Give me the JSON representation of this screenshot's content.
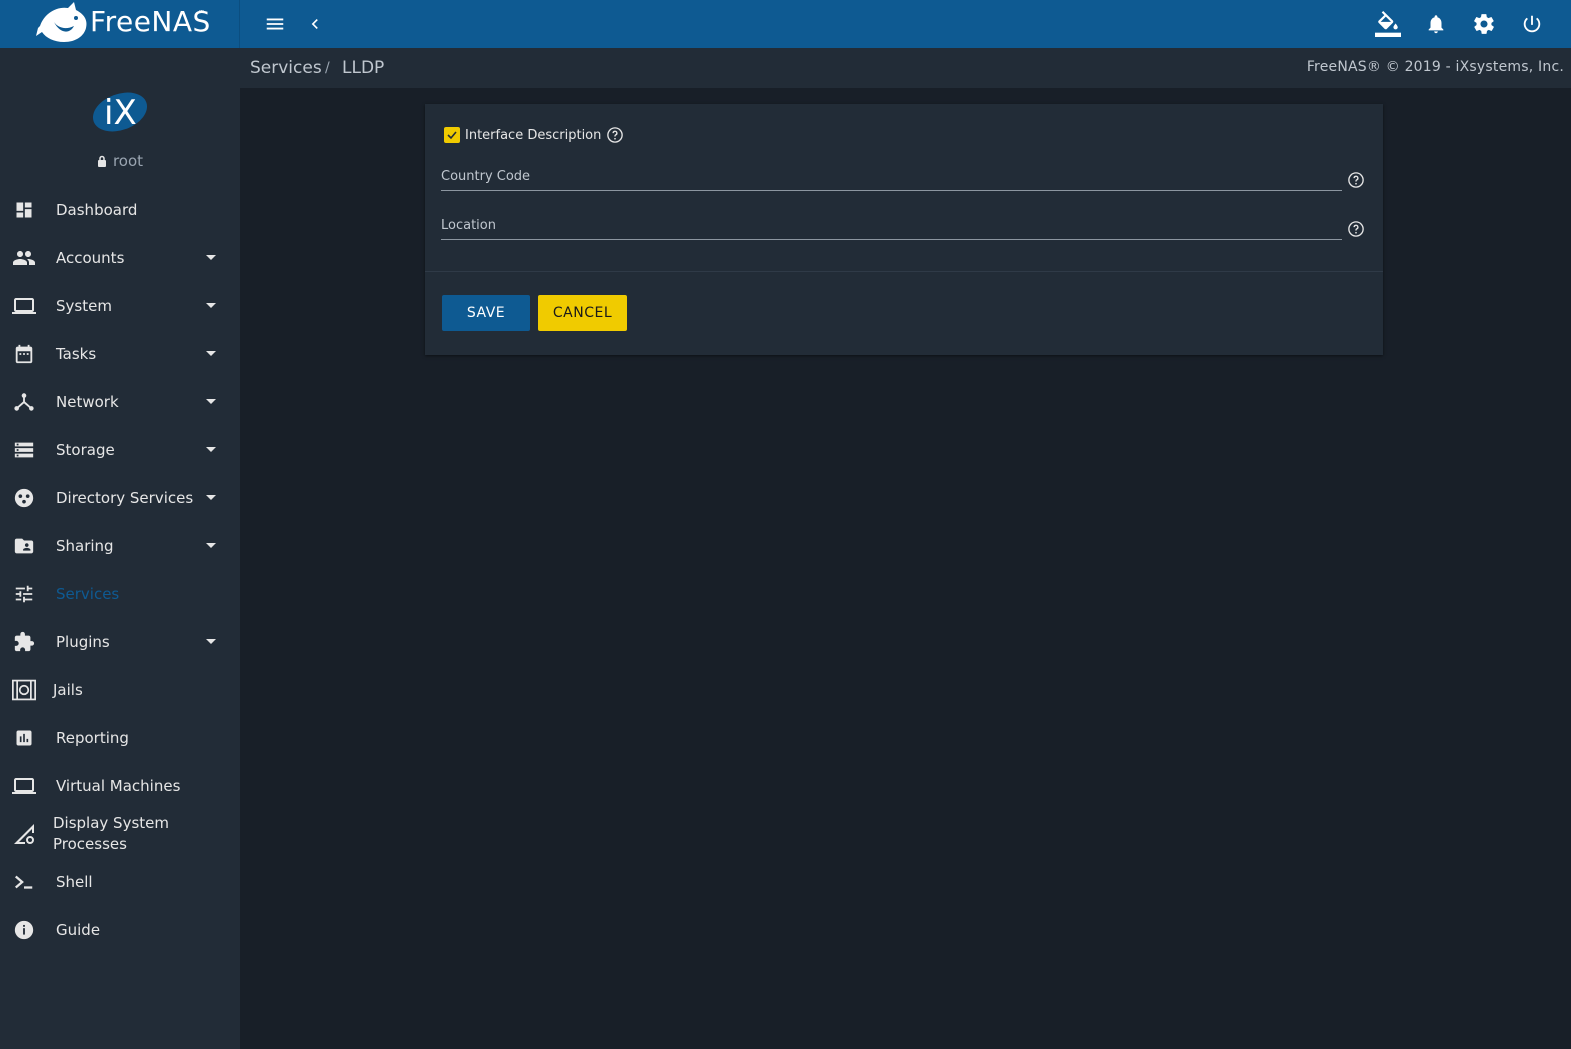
{
  "app": {
    "brand": "FreeNAS",
    "brand_tm": "™"
  },
  "colors": {
    "topbar": "#0e5a92",
    "sidebar": "#222c37",
    "background": "#181f28",
    "accent_yellow": "#f0cb00",
    "active_nav": "#0e5a92"
  },
  "topbar": {
    "icons": [
      "menu-icon",
      "chevron-left-icon",
      "paint-bucket-icon",
      "bell-icon",
      "gear-icon",
      "power-icon"
    ]
  },
  "user": {
    "name": "root"
  },
  "sidebar": {
    "items": [
      {
        "label": "Dashboard",
        "icon": "dashboard-icon",
        "expandable": false
      },
      {
        "label": "Accounts",
        "icon": "people-icon",
        "expandable": true
      },
      {
        "label": "System",
        "icon": "laptop-icon",
        "expandable": true
      },
      {
        "label": "Tasks",
        "icon": "calendar-icon",
        "expandable": true
      },
      {
        "label": "Network",
        "icon": "network-icon",
        "expandable": true
      },
      {
        "label": "Storage",
        "icon": "storage-icon",
        "expandable": true
      },
      {
        "label": "Directory Services",
        "icon": "directory-icon",
        "expandable": true
      },
      {
        "label": "Sharing",
        "icon": "shared-folder-icon",
        "expandable": true
      },
      {
        "label": "Services",
        "icon": "tune-icon",
        "expandable": false,
        "active": true
      },
      {
        "label": "Plugins",
        "icon": "puzzle-icon",
        "expandable": true
      },
      {
        "label": "Jails",
        "icon": "jail-icon",
        "expandable": false
      },
      {
        "label": "Reporting",
        "icon": "bar-chart-icon",
        "expandable": false
      },
      {
        "label": "Virtual Machines",
        "icon": "computer-icon",
        "expandable": false
      },
      {
        "label": "Display System Processes",
        "icon": "network-cog-icon",
        "expandable": false
      },
      {
        "label": "Shell",
        "icon": "terminal-icon",
        "expandable": false
      },
      {
        "label": "Guide",
        "icon": "info-icon",
        "expandable": false
      }
    ]
  },
  "breadcrumb": {
    "parent": "Services",
    "separator": "/",
    "current": "LLDP"
  },
  "copyright": "FreeNAS® © 2019 - iXsystems, Inc.",
  "form": {
    "interface_description": {
      "label": "Interface Description",
      "checked": true
    },
    "country_code": {
      "label": "Country Code",
      "value": ""
    },
    "location": {
      "label": "Location",
      "value": ""
    },
    "save_label": "SAVE",
    "cancel_label": "CANCEL"
  }
}
